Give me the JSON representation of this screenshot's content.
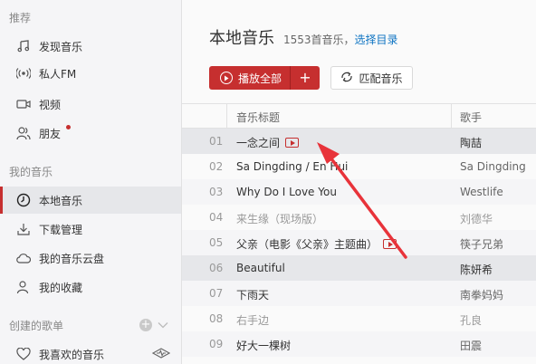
{
  "sidebar": {
    "recommend_title": "推荐",
    "recommend_items": [
      {
        "label": "发现音乐",
        "icon": "music-note-icon"
      },
      {
        "label": "私人FM",
        "icon": "radio-icon"
      },
      {
        "label": "视频",
        "icon": "video-icon"
      },
      {
        "label": "朋友",
        "icon": "friends-icon"
      }
    ],
    "mymusic_title": "我的音乐",
    "mymusic_items": [
      {
        "label": "本地音乐",
        "icon": "clock-icon"
      },
      {
        "label": "下载管理",
        "icon": "download-icon"
      },
      {
        "label": "我的音乐云盘",
        "icon": "cloud-icon"
      },
      {
        "label": "我的收藏",
        "icon": "collection-icon"
      }
    ],
    "playlist_title": "创建的歌单",
    "playlist_items": [
      {
        "label": "我喜欢的音乐",
        "icon": "heart-icon"
      }
    ]
  },
  "main": {
    "title": "本地音乐",
    "count_text": "1553首音乐，",
    "select_dir": "选择目录",
    "play_all": "播放全部",
    "match": "匹配音乐"
  },
  "table": {
    "col_title": "音乐标题",
    "col_artist": "歌手",
    "rows": [
      {
        "num": "01",
        "name": "一念之间",
        "artist": "陶喆"
      },
      {
        "num": "02",
        "name": "Sa Dingding / En Hui",
        "artist": "Sa Dingding"
      },
      {
        "num": "03",
        "name": "Why Do I Love You",
        "artist": "Westlife"
      },
      {
        "num": "04",
        "name": "来生缘（现场版）",
        "artist": "刘德华"
      },
      {
        "num": "05",
        "name": "父亲（电影《父亲》主题曲）",
        "artist": "筷子兄弟"
      },
      {
        "num": "06",
        "name": "Beautiful",
        "artist": "陈妍希"
      },
      {
        "num": "07",
        "name": "下雨天",
        "artist": "南拳妈妈"
      },
      {
        "num": "08",
        "name": "右手边",
        "artist": "孔良"
      },
      {
        "num": "09",
        "name": "好大一棵树",
        "artist": "田震"
      }
    ]
  },
  "colors": {
    "accent": "#c62f2f",
    "link": "#0c73c2"
  }
}
